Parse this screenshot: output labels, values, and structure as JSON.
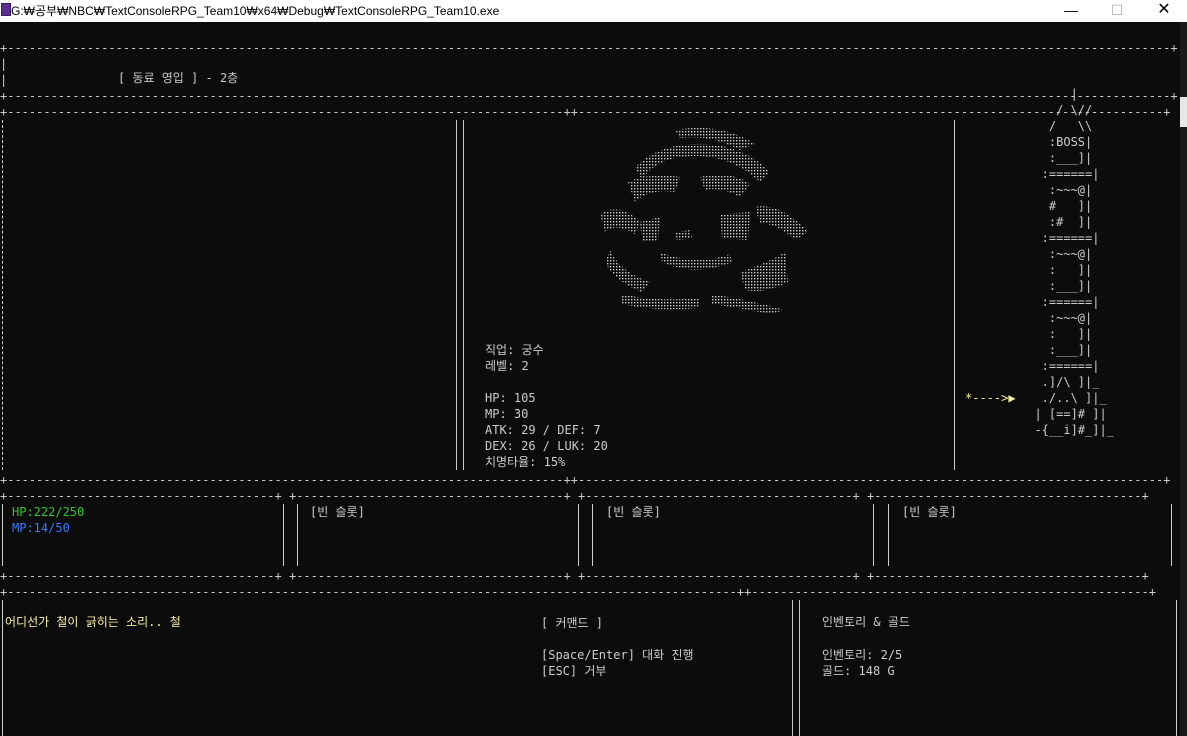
{
  "window": {
    "title": "G:₩공부₩NBC₩TextConsoleRPG_Team10₩x64₩Debug₩TextConsoleRPG_Team10.exe",
    "minimize": "—",
    "maximize": "☐",
    "close": "✕"
  },
  "header": {
    "title": "[ 동료 영입 ] - 2층"
  },
  "character": {
    "job_line": "직업: 궁수",
    "level_line": "레벨: 2",
    "hp_line": "HP: 105",
    "mp_line": "MP: 30",
    "atk_def_line": "ATK: 29 / DEF: 7",
    "dex_luk_line": "DEX: 26 / LUK: 20",
    "crit_line": "치명타율: 15%"
  },
  "tower": {
    "art": "       |\n     / \\//\n    /   \\\\\n    :BOSS|\n    :___]|\n   :======|\n    :~~~@|\n    #   ]|\n    :#  ]|\n   :======|\n    :~~~@|\n    :   ]|\n    :___]|\n   :======|\n    :~~~@|\n    :   ]|\n    :___]|\n   :======|\n   .]/\\ ]|_\n   ./..\\ ]|_\n  | [==]# ]|\n  -{__i]#_]|_",
    "marker": "*---->"
  },
  "party": {
    "player_hp": "HP:222/250",
    "player_mp": "MP:14/50",
    "slot1": "[빈 슬롯]",
    "slot2": "[빈 슬롯]",
    "slot3": "[빈 슬롯]"
  },
  "message": {
    "text": "어디선가 철이 긁히는 소리.. 철"
  },
  "commands": {
    "title": "[ 커맨드 ]",
    "line1": "[Space/Enter] 대화 진행",
    "line2": "[ESC] 거부"
  },
  "inventory": {
    "title": "인벤토리 & 골드",
    "items_line": "인벤토리: 2/5",
    "gold_line": "골드: 148 G"
  },
  "colors": {
    "background": "#0c0c0c",
    "text": "#cccccc",
    "hp": "#2ec62e",
    "mp": "#3b78ff",
    "message": "#f9f1a5",
    "marker": "#f9f1a5"
  }
}
